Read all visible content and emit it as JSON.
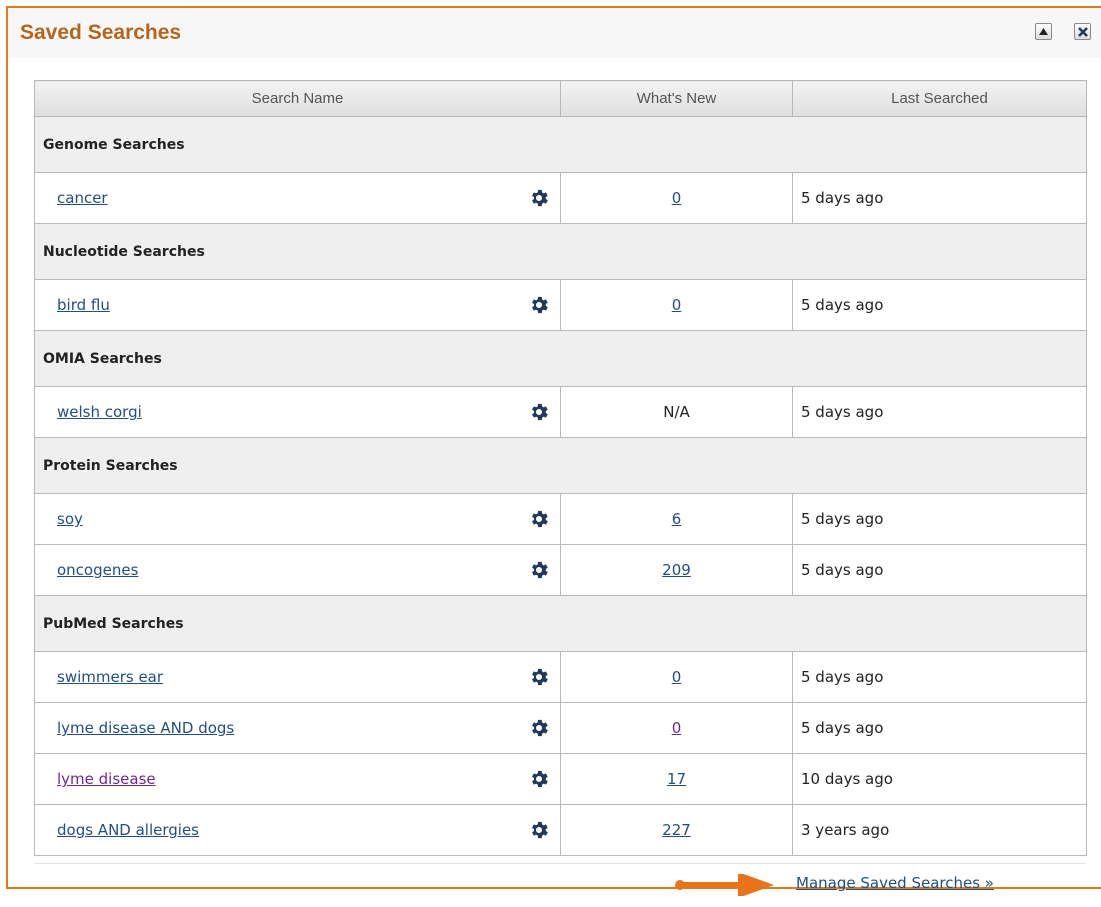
{
  "panel": {
    "title": "Saved Searches",
    "accent_color": "#e07a1a",
    "collapse_icon": "triangle-up-icon",
    "close_icon": "close-x-icon"
  },
  "table": {
    "headers": [
      "Search Name",
      "What's New",
      "Last Searched"
    ],
    "groups": [
      {
        "label": "Genome Searches",
        "items": [
          {
            "name": "cancer",
            "new": "0",
            "new_link": true,
            "last": "5 days ago"
          }
        ]
      },
      {
        "label": "Nucleotide Searches",
        "items": [
          {
            "name": "bird flu",
            "new": "0",
            "new_link": true,
            "last": "5 days ago"
          }
        ]
      },
      {
        "label": "OMIA Searches",
        "items": [
          {
            "name": "welsh corgi",
            "new": "N/A",
            "new_link": false,
            "last": "5 days ago"
          }
        ]
      },
      {
        "label": "Protein Searches",
        "items": [
          {
            "name": "soy",
            "new": "6",
            "new_link": true,
            "last": "5 days ago"
          },
          {
            "name": "oncogenes",
            "new": "209",
            "new_link": true,
            "last": "5 days ago"
          }
        ]
      },
      {
        "label": "PubMed Searches",
        "items": [
          {
            "name": "swimmers ear",
            "new": "0",
            "new_link": true,
            "last": "5 days ago"
          },
          {
            "name": "lyme disease AND dogs",
            "new": "0",
            "new_link": true,
            "new_visited": true,
            "last": "5 days ago"
          },
          {
            "name": "lyme disease",
            "name_visited": true,
            "new": "17",
            "new_link": true,
            "last": "10 days ago"
          },
          {
            "name": "dogs AND allergies",
            "new": "227",
            "new_link": true,
            "last": "3 years ago"
          }
        ]
      }
    ],
    "row_icon": "gear-icon"
  },
  "footer": {
    "manage_label": "Manage Saved Searches »",
    "arrow_icon": "arrow-right-icon",
    "arrow_color": "#e8731a"
  }
}
